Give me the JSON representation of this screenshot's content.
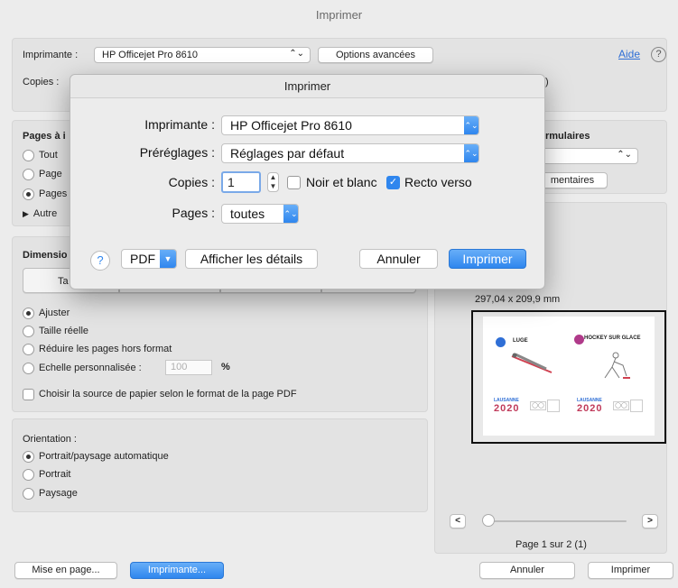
{
  "window": {
    "title": "Imprimer"
  },
  "top": {
    "printer_label": "Imprimante :",
    "printer_value": "HP Officejet Pro 8610",
    "advanced_button": "Options avancées",
    "help_link": "Aide",
    "help_icon": "?",
    "copies_label": "Copies :",
    "copies_suffix": ")"
  },
  "pages": {
    "heading": "Pages à i",
    "options": [
      {
        "label": "Tout",
        "selected": false
      },
      {
        "label": "Page",
        "selected": false
      },
      {
        "label": "Pages",
        "selected": true
      }
    ],
    "other": "Autre"
  },
  "forms": {
    "heading": "rmulaires",
    "button": "mentaires"
  },
  "dimensions": {
    "heading": "Dimensio",
    "tab": "Ta",
    "size_text": "297,04 x 209,9 mm",
    "options": [
      {
        "label": "Ajuster",
        "selected": true
      },
      {
        "label": "Taille réelle",
        "selected": false
      },
      {
        "label": "Réduire les pages hors format",
        "selected": false
      },
      {
        "label": "Echelle personnalisée :",
        "selected": false
      }
    ],
    "scale_value": "100",
    "scale_unit": "%",
    "paper_source": "Choisir la source de papier selon le format de la page PDF"
  },
  "orientation": {
    "heading": "Orientation :",
    "options": [
      {
        "label": "Portrait/paysage automatique",
        "selected": true
      },
      {
        "label": "Portrait",
        "selected": false
      },
      {
        "label": "Paysage",
        "selected": false
      }
    ]
  },
  "preview": {
    "left_label": "LUGE",
    "right_label": "HOCKEY SUR GLACE",
    "year_left": "2020",
    "year_right": "2020",
    "brand": "LAUSANNE",
    "page_info": "Page 1 sur 2 (1)",
    "prev": "<",
    "next": ">"
  },
  "bottom": {
    "page_setup": "Mise en page...",
    "printer": "Imprimante...",
    "cancel": "Annuler",
    "print": "Imprimer"
  },
  "dialog": {
    "title": "Imprimer",
    "printer_label": "Imprimante :",
    "printer_value": "HP Officejet Pro 8610",
    "presets_label": "Préréglages :",
    "presets_value": "Réglages par défaut",
    "copies_label": "Copies :",
    "copies_value": "1",
    "bw_label": "Noir et blanc",
    "bw_checked": false,
    "duplex_label": "Recto verso",
    "duplex_checked": true,
    "pages_label": "Pages :",
    "pages_value": "toutes",
    "help": "?",
    "pdf": "PDF",
    "details": "Afficher les détails",
    "cancel": "Annuler",
    "print": "Imprimer"
  },
  "colors": {
    "accent": "#2f86ee",
    "link": "#2f6fd6"
  }
}
